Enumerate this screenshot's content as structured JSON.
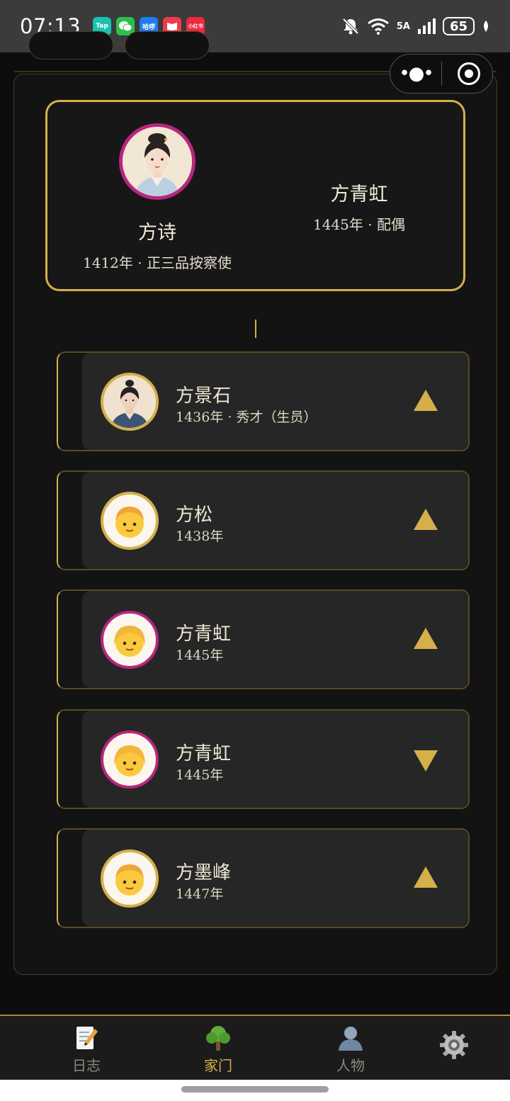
{
  "status_bar": {
    "time": "07:13",
    "apps": [
      {
        "label": "Tap",
        "color": "#19c2b0"
      },
      {
        "label": "",
        "color": "#2bc04c"
      },
      {
        "label": "哈啰",
        "color": "#1e7cf2"
      },
      {
        "label": "",
        "color": "#ef3a4e"
      },
      {
        "label": "小红书",
        "color": "#ef2840"
      }
    ],
    "network": "5A",
    "battery": "65"
  },
  "parent_card": {
    "main": {
      "name": "方诗",
      "meta": "1412年 · 正三品按察使"
    },
    "spouse": {
      "name": "方青虹",
      "meta": "1445年 · 配偶"
    }
  },
  "children": [
    {
      "name": "方景石",
      "meta": "1436年 · 秀才（生员）",
      "avatar": "scholar-portrait",
      "gender": "male",
      "arrow": "up"
    },
    {
      "name": "方松",
      "meta": "1438年",
      "avatar": "boy-emoji",
      "gender": "male",
      "arrow": "up"
    },
    {
      "name": "方青虹",
      "meta": "1445年",
      "avatar": "girl-emoji",
      "gender": "female",
      "arrow": "up"
    },
    {
      "name": "方青虹",
      "meta": "1445年",
      "avatar": "girl-emoji",
      "gender": "female",
      "arrow": "down"
    },
    {
      "name": "方墨峰",
      "meta": "1447年",
      "avatar": "boy-emoji",
      "gender": "male",
      "arrow": "up"
    }
  ],
  "nav": {
    "items": [
      {
        "label": "日志",
        "icon": "memo-icon"
      },
      {
        "label": "家门",
        "icon": "tree-icon",
        "active": true
      },
      {
        "label": "人物",
        "icon": "person-icon"
      },
      {
        "label": "",
        "icon": "gear-icon"
      }
    ]
  },
  "colors": {
    "accent": "#d4b04a",
    "female_ring": "#b8267f",
    "background": "#0d0d0d"
  }
}
